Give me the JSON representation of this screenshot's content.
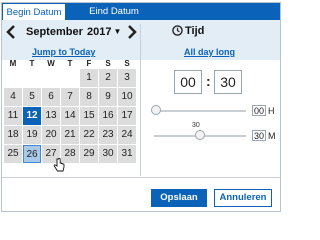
{
  "tabs": [
    {
      "label": "Begin Datum",
      "active": true
    },
    {
      "label": "Eind Datum",
      "active": false
    }
  ],
  "calendar": {
    "month": "September",
    "year": "2017",
    "jump_link": "Jump to Today",
    "weekdays": [
      "M",
      "T",
      "W",
      "T",
      "F",
      "S",
      "S"
    ],
    "days": [
      "",
      "",
      "",
      "",
      "1",
      "2",
      "3",
      "4",
      "5",
      "6",
      "7",
      "8",
      "9",
      "10",
      "11",
      "12",
      "13",
      "14",
      "15",
      "16",
      "17",
      "18",
      "19",
      "20",
      "21",
      "22",
      "23",
      "24",
      "25",
      "26",
      "27",
      "28",
      "29",
      "30",
      "31",
      "",
      ""
    ],
    "selected_day": "12",
    "hovered_day": "26"
  },
  "time": {
    "title": "Tijd",
    "all_day_link": "All day long",
    "hours": "00",
    "minutes": "30",
    "hour_slider": {
      "value": "00",
      "unit": "H",
      "fraction": 0
    },
    "minute_slider": {
      "value": "30",
      "unit": "M",
      "fraction": 0.5,
      "label": "30"
    }
  },
  "buttons": {
    "save": "Opslaan",
    "cancel": "Annuleren"
  },
  "colors": {
    "accent": "#0a63b8",
    "header_bg": "#e3edf5",
    "cell_gray": "#dcdcdc"
  }
}
